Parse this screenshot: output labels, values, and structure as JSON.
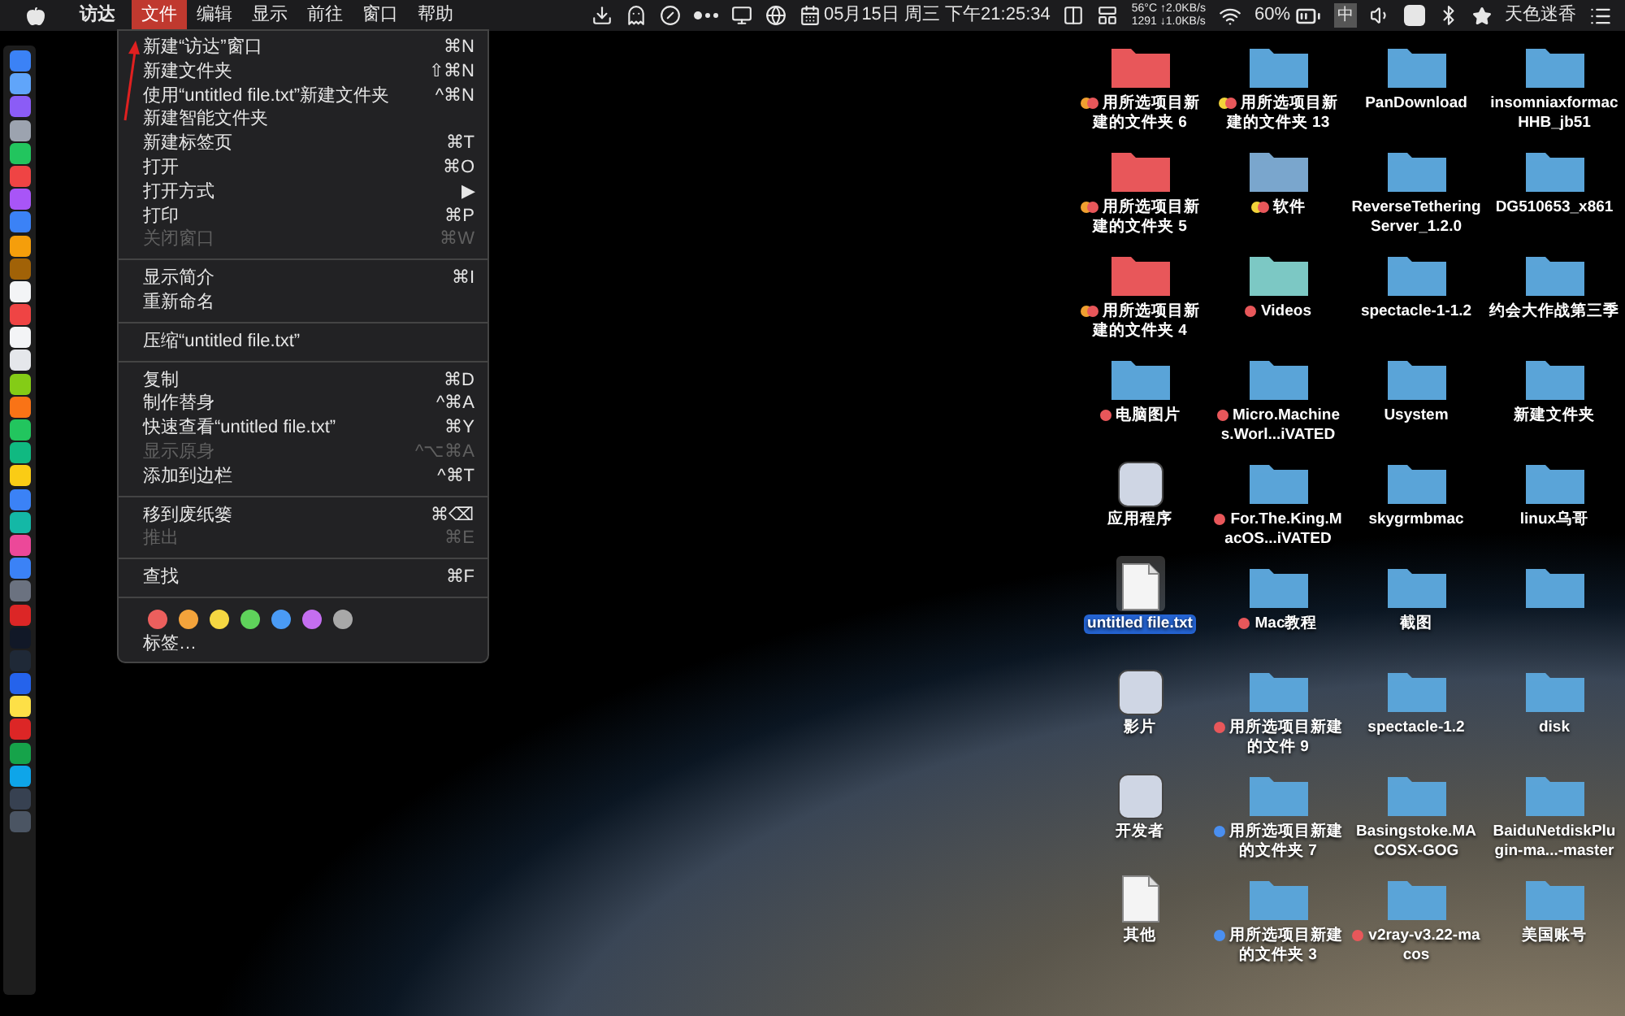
{
  "menu_bar": {
    "app_name": "访达",
    "menus": [
      {
        "label": "文件",
        "selected": true
      },
      {
        "label": "编辑",
        "selected": false
      },
      {
        "label": "显示",
        "selected": false
      },
      {
        "label": "前往",
        "selected": false
      },
      {
        "label": "窗口",
        "selected": false
      },
      {
        "label": "帮助",
        "selected": false
      }
    ],
    "clock": "05月15日 周三 下午21:25:34",
    "stats_top": "56°C ↑2.0KB/s",
    "stats_bottom": "1291 ↓1.0KB/s",
    "battery_text": "60%",
    "input_method": "中",
    "user_name": "天色迷香"
  },
  "file_menu": {
    "groups": [
      [
        {
          "label": "新建“访达”窗口",
          "shortcut": "⌘N",
          "disabled": false
        },
        {
          "label": "新建文件夹",
          "shortcut": "⇧⌘N",
          "disabled": false
        },
        {
          "label": "使用“untitled file.txt”新建文件夹",
          "shortcut": "^⌘N",
          "disabled": false
        },
        {
          "label": "新建智能文件夹",
          "disabled": false
        },
        {
          "label": "新建标签页",
          "shortcut": "⌘T",
          "disabled": false
        },
        {
          "label": "打开",
          "shortcut": "⌘O",
          "disabled": false
        },
        {
          "label": "打开方式",
          "shortcut": "▶",
          "disabled": false
        },
        {
          "label": "打印",
          "shortcut": "⌘P",
          "disabled": false
        },
        {
          "label": "关闭窗口",
          "shortcut": "⌘W",
          "disabled": true
        }
      ],
      [
        {
          "label": "显示简介",
          "shortcut": "⌘I",
          "disabled": false
        },
        {
          "label": "重新命名",
          "disabled": false
        }
      ],
      [
        {
          "label": "压缩“untitled file.txt”",
          "disabled": false
        }
      ],
      [
        {
          "label": "复制",
          "shortcut": "⌘D",
          "disabled": false
        },
        {
          "label": "制作替身",
          "shortcut": "^⌘A",
          "disabled": false
        },
        {
          "label": "快速查看“untitled file.txt”",
          "shortcut": "⌘Y",
          "disabled": false
        },
        {
          "label": "显示原身",
          "shortcut": "^⌥⌘A",
          "disabled": true
        },
        {
          "label": "添加到边栏",
          "shortcut": "^⌘T",
          "disabled": false
        }
      ],
      [
        {
          "label": "移到废纸篓",
          "shortcut": "⌘⌫",
          "disabled": false
        },
        {
          "label": "推出",
          "shortcut": "⌘E",
          "disabled": true
        }
      ],
      [
        {
          "label": "查找",
          "shortcut": "⌘F",
          "disabled": false
        }
      ]
    ],
    "tag_colors": [
      {
        "color": "#ec5f5d"
      },
      {
        "color": "#f3a33b"
      },
      {
        "color": "#f5d742"
      },
      {
        "color": "#5fd35b"
      },
      {
        "color": "#4a9bf5"
      },
      {
        "color": "#c46ef0"
      },
      {
        "color": "#a8a8a8"
      }
    ],
    "tags_item": "标签…"
  },
  "desktop": {
    "items": [
      {
        "kind": "folder",
        "color": "#e8575a",
        "label": "用所选项目新建的文件夹 6",
        "tags": [
          {
            "color": "#f0a030"
          },
          {
            "color": "#e8575a"
          }
        ],
        "selected": false
      },
      {
        "kind": "folder",
        "color": "#5ba4d8",
        "label": "用所选项目新建的文件夹 13",
        "tags": [
          {
            "color": "#f2d33a"
          },
          {
            "color": "#e8575a"
          }
        ],
        "selected": false
      },
      {
        "kind": "folder",
        "color": "#5ba4d8",
        "label": "PanDownload",
        "selected": false
      },
      {
        "kind": "folder",
        "color": "#5ba4d8",
        "label": "insomniaxformacHHB_jb51",
        "selected": false
      },
      {
        "kind": "folder",
        "color": "#e8575a",
        "label": "用所选项目新建的文件夹 5",
        "tags": [
          {
            "color": "#f0a030"
          },
          {
            "color": "#e8575a"
          }
        ],
        "selected": false
      },
      {
        "kind": "folder",
        "color": "#7aa6cc",
        "label": "软件",
        "tags": [
          {
            "color": "#f2d33a"
          },
          {
            "color": "#e8575a"
          }
        ],
        "selected": false
      },
      {
        "kind": "folder",
        "color": "#5ba4d8",
        "label": "ReverseTetheringServer_1.2.0",
        "selected": false
      },
      {
        "kind": "folder",
        "color": "#5ba4d8",
        "label": "DG510653_x861",
        "selected": false
      },
      {
        "kind": "folder",
        "color": "#e8575a",
        "label": "用所选项目新建的文件夹 4",
        "tags": [
          {
            "color": "#f0a030"
          },
          {
            "color": "#e8575a"
          }
        ],
        "selected": false
      },
      {
        "kind": "folder",
        "color": "#7cc8c4",
        "label": "Videos",
        "tags": [
          {
            "color": "#e8575a"
          }
        ],
        "selected": false
      },
      {
        "kind": "folder",
        "color": "#5ba4d8",
        "label": "spectacle-1-1.2",
        "selected": false
      },
      {
        "kind": "folder",
        "color": "#5ba4d8",
        "label": "约会大作战第三季",
        "selected": false
      },
      {
        "kind": "folder",
        "color": "#5ba4d8",
        "label": "电脑图片",
        "tags": [
          {
            "color": "#e8575a"
          }
        ],
        "selected": false
      },
      {
        "kind": "folder",
        "color": "#5ba4d8",
        "label": "Micro.Machines.Worl...iVATED",
        "tags": [
          {
            "color": "#e8575a"
          }
        ],
        "selected": false
      },
      {
        "kind": "folder",
        "color": "#5ba4d8",
        "label": "Usystem",
        "selected": false
      },
      {
        "kind": "folder",
        "color": "#5ba4d8",
        "label": "新建文件夹",
        "selected": false
      },
      {
        "kind": "app",
        "label": "应用程序",
        "selected": false
      },
      {
        "kind": "folder",
        "color": "#5ba4d8",
        "label": "For.The.King.MacOS...iVATED",
        "tags": [
          {
            "color": "#e8575a"
          }
        ],
        "selected": false
      },
      {
        "kind": "folder",
        "color": "#5ba4d8",
        "label": "skygrmbmac",
        "selected": false
      },
      {
        "kind": "folder",
        "color": "#5ba4d8",
        "label": "linux乌哥",
        "selected": false
      },
      {
        "kind": "document",
        "label": "untitled file.txt",
        "selected": true
      },
      {
        "kind": "folder",
        "color": "#5ba4d8",
        "label": "Mac教程",
        "tags": [
          {
            "color": "#e8575a"
          }
        ],
        "selected": false
      },
      {
        "kind": "folder",
        "color": "#5ba4d8",
        "label": "截图",
        "selected": false
      },
      {
        "kind": "folder",
        "color": "#5ba4d8"
      },
      {
        "kind": "app",
        "label": "影片",
        "selected": false
      },
      {
        "kind": "folder",
        "color": "#5ba4d8",
        "label": "用所选项目新建的文件 9",
        "tags": [
          {
            "color": "#e8575a"
          }
        ],
        "selected": false
      },
      {
        "kind": "folder",
        "color": "#5ba4d8",
        "label": "spectacle-1.2",
        "selected": false
      },
      {
        "kind": "folder",
        "color": "#5ba4d8",
        "label": "disk",
        "selected": false
      },
      {
        "kind": "app",
        "label": "开发者",
        "selected": false
      },
      {
        "kind": "folder",
        "color": "#5ba4d8",
        "label": "用所选项目新建的文件夹 7",
        "tags": [
          {
            "color": "#4a8ff0"
          }
        ],
        "selected": false
      },
      {
        "kind": "folder",
        "color": "#5ba4d8",
        "label": "Basingstoke.MACOSX-GOG",
        "selected": false
      },
      {
        "kind": "folder",
        "color": "#5ba4d8",
        "label": "BaiduNetdiskPlugin-ma...-master",
        "selected": false
      },
      {
        "kind": "document",
        "label": "其他",
        "selected": false
      },
      {
        "kind": "folder",
        "color": "#5ba4d8",
        "label": "用所选项目新建的文件夹 3",
        "tags": [
          {
            "color": "#4a8ff0"
          }
        ],
        "selected": false
      },
      {
        "kind": "folder",
        "color": "#5ba4d8",
        "label": "v2ray-v3.22-macos",
        "tags": [
          {
            "color": "#e8575a"
          }
        ],
        "selected": false
      },
      {
        "kind": "folder",
        "color": "#5ba4d8",
        "label": "美国账号",
        "selected": false
      }
    ]
  }
}
